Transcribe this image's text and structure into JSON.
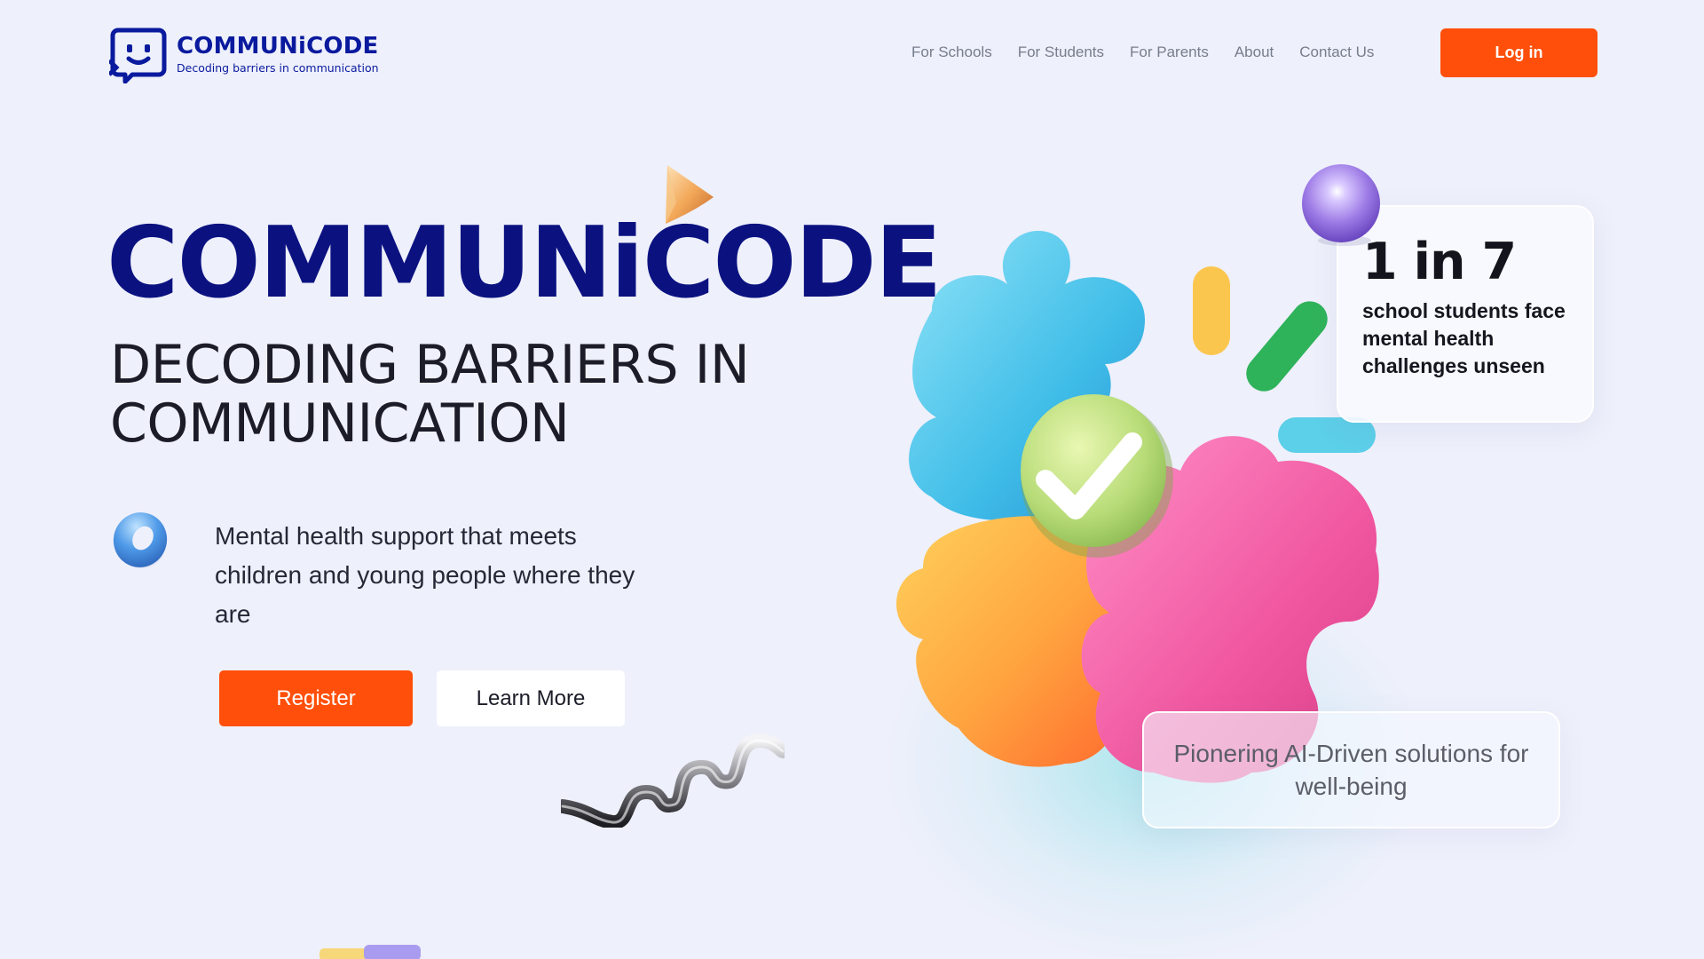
{
  "header": {
    "logo": {
      "name": "COMMUNiCODE",
      "tagline": "Decoding barriers in communication",
      "icon": "chat-face-icon"
    },
    "nav": [
      "For Schools",
      "For Students",
      "For Parents",
      "About",
      "Contact Us"
    ],
    "login_label": "Log in"
  },
  "hero": {
    "title": "COMMUNiCODE",
    "subtitle_line1": "DECODING BARRIERS IN",
    "subtitle_line2": "COMMUNICATION",
    "description": "Mental health support that meets children and young people where they are",
    "register_label": "Register",
    "learn_more_label": "Learn More"
  },
  "stat_card": {
    "value": "1 in 7",
    "text": "school students face mental health challenges unseen"
  },
  "pioneer_card": {
    "text": "Pionering AI-Driven solutions for well-being"
  },
  "colors": {
    "background": "#eef0fb",
    "brand_navy": "#0b1280",
    "brand_blue": "#0a1a9e",
    "accent_orange": "#ff4f0a",
    "nav_gray": "#777d8c"
  },
  "decorations": [
    "cone-icon",
    "torus-ring-icon",
    "spring-coil-icon",
    "puzzle-pieces-illustration",
    "checkmark-icon",
    "purple-sphere-icon",
    "capsule-shapes"
  ]
}
